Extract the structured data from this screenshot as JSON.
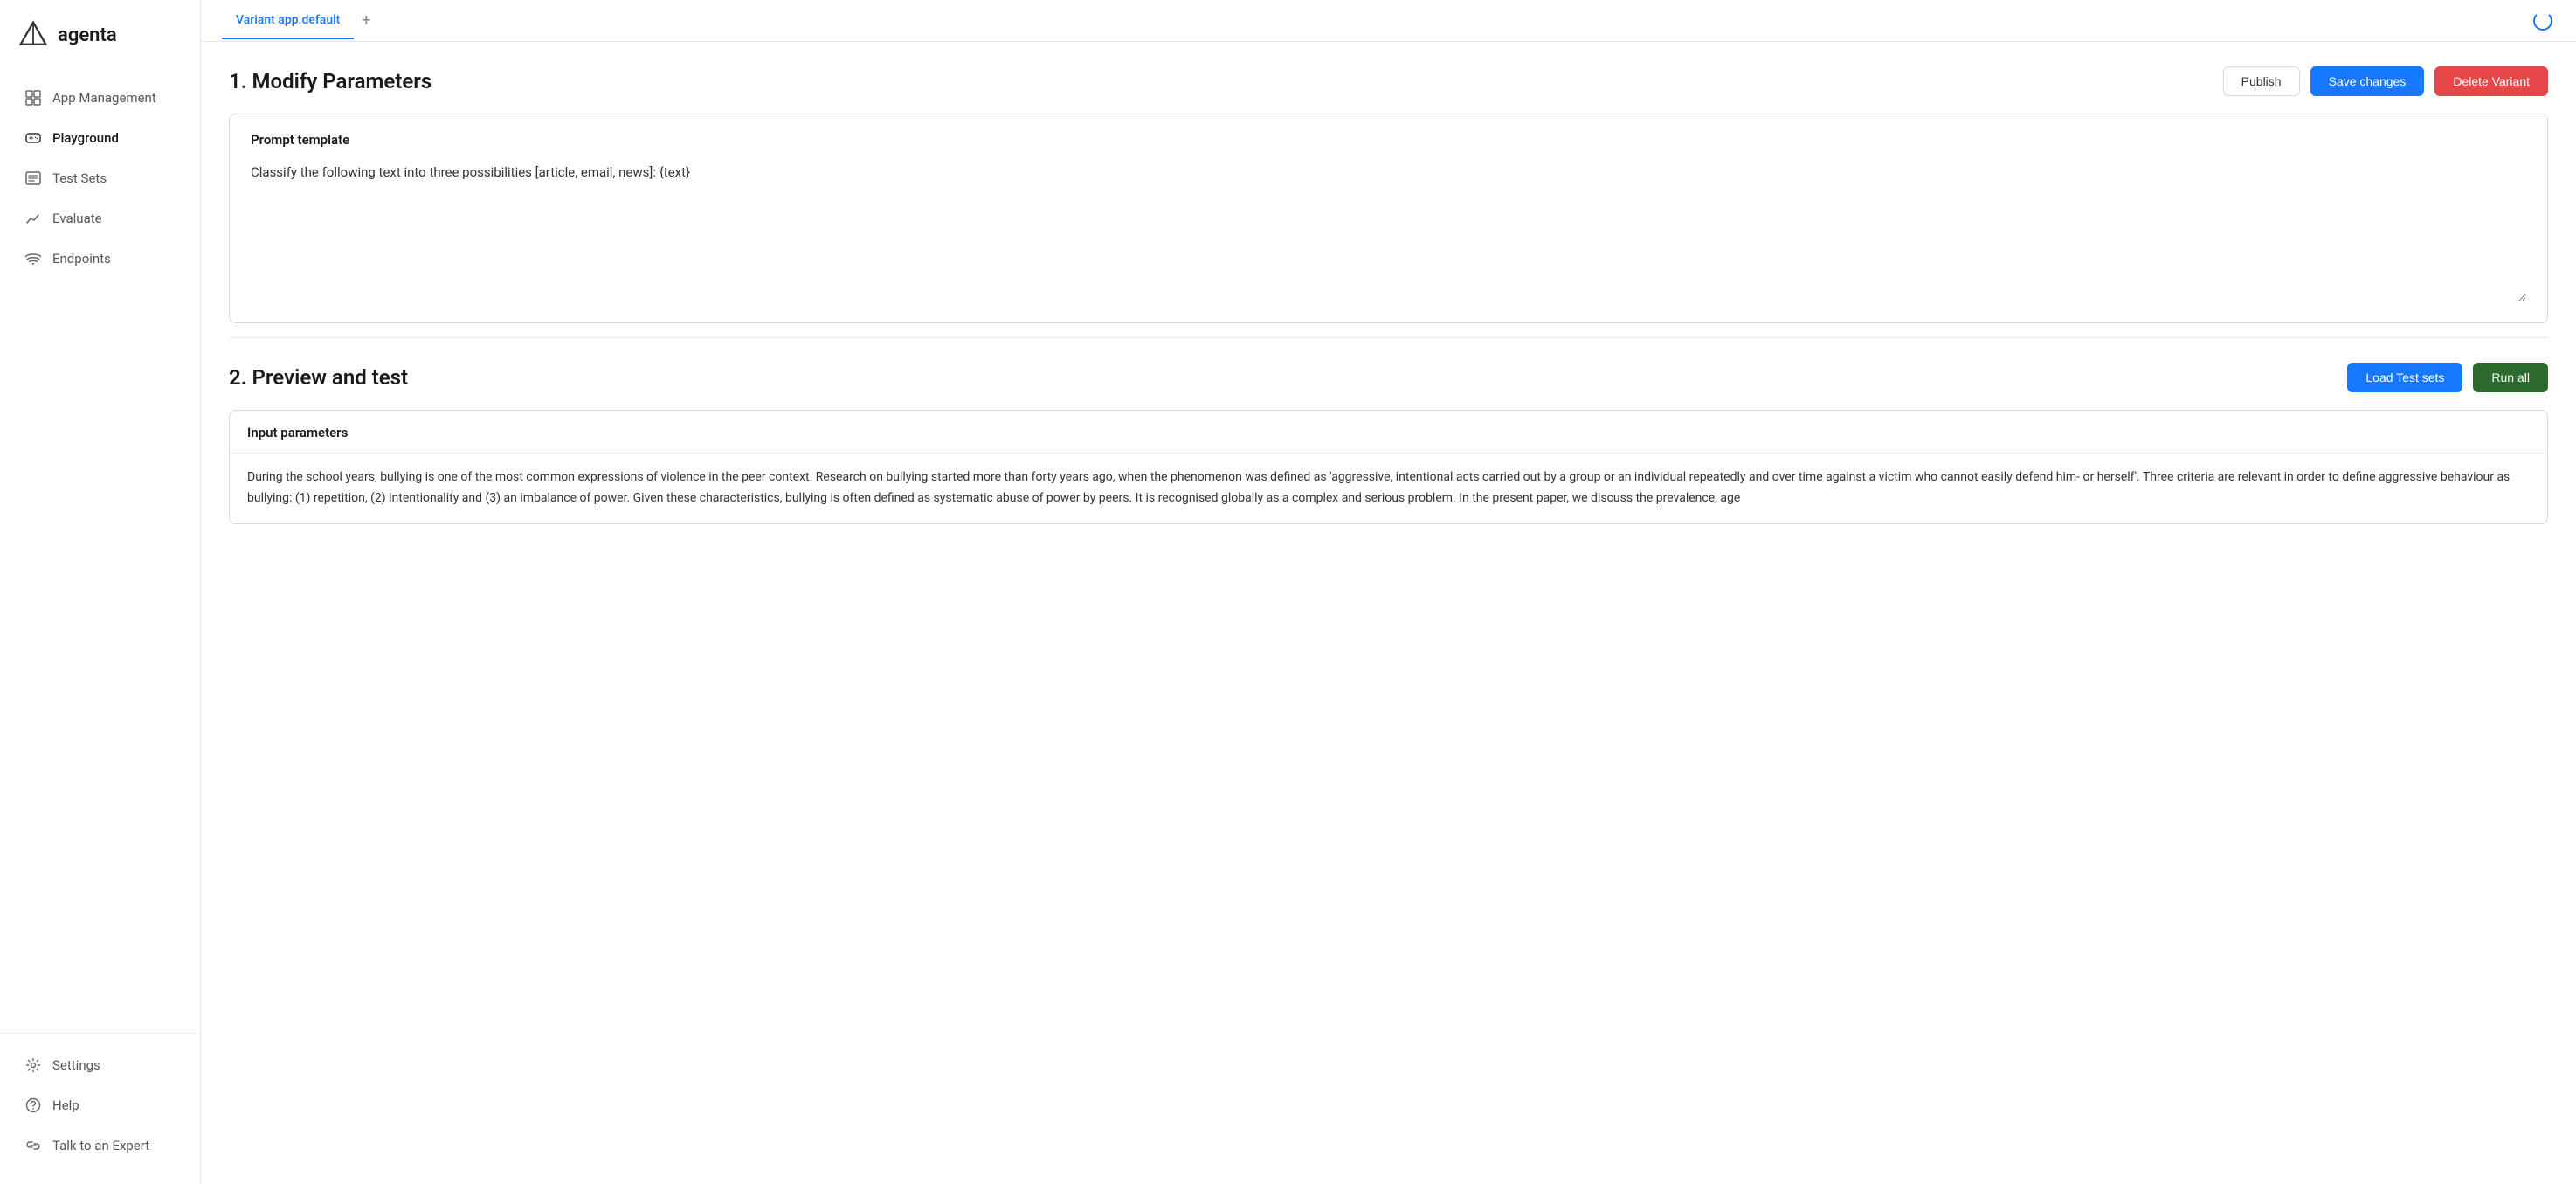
{
  "logo": {
    "text": "agenta"
  },
  "sidebar": {
    "nav_items": [
      {
        "id": "app-management",
        "label": "App Management",
        "icon": "grid-icon"
      },
      {
        "id": "playground",
        "label": "Playground",
        "icon": "gamepad-icon",
        "active": true
      },
      {
        "id": "test-sets",
        "label": "Test Sets",
        "icon": "list-icon"
      },
      {
        "id": "evaluate",
        "label": "Evaluate",
        "icon": "chart-icon"
      },
      {
        "id": "endpoints",
        "label": "Endpoints",
        "icon": "wifi-icon"
      }
    ],
    "bottom_items": [
      {
        "id": "settings",
        "label": "Settings",
        "icon": "settings-icon"
      },
      {
        "id": "help",
        "label": "Help",
        "icon": "help-icon"
      },
      {
        "id": "talk-to-expert",
        "label": "Talk to an Expert",
        "icon": "link-icon"
      }
    ]
  },
  "tabs": [
    {
      "id": "variant-default",
      "label": "Variant app.default",
      "active": true
    }
  ],
  "tab_add_label": "+",
  "section1": {
    "title": "1. Modify Parameters",
    "publish_label": "Publish",
    "save_label": "Save changes",
    "delete_label": "Delete Variant",
    "prompt_card": {
      "title": "Prompt template",
      "content": "Classify the following text into three possibilities [article, email, news]: {text}"
    }
  },
  "section2": {
    "title": "2. Preview and test",
    "load_test_label": "Load Test sets",
    "run_all_label": "Run all",
    "input_params": {
      "title": "Input parameters",
      "body": "During the school years, bullying is one of the most common expressions of violence in the peer context. Research on bullying started more than forty years ago, when the phenomenon was defined as 'aggressive, intentional acts carried out by a group or an individual repeatedly and over time against a victim who cannot easily defend him- or herself'. Three criteria are relevant in order to define aggressive behaviour as bullying: (1) repetition, (2) intentionality and (3) an imbalance of power. Given these characteristics, bullying is often defined as systematic abuse of power by peers. It is recognised globally as a complex and serious problem. In the present paper, we discuss the prevalence, age"
    }
  },
  "colors": {
    "primary": "#1677ff",
    "danger": "#e84749",
    "dark_green": "#2d6a2d",
    "tab_active": "#1677ff"
  }
}
